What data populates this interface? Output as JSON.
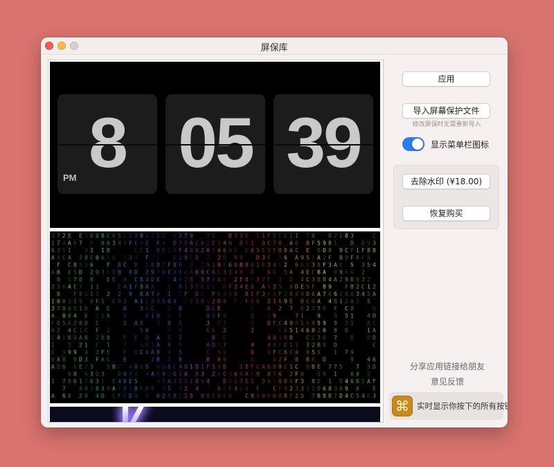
{
  "window": {
    "title": "屏保库"
  },
  "previews": {
    "clock": {
      "hour": "8",
      "minute": "05",
      "second": "39",
      "ampm": "PM"
    },
    "matrix": {
      "chars": "0123456789ABCDEF",
      "colors": [
        "#6fcf3a",
        "#2ec4a6",
        "#2f7fe0",
        "#7a3cf0",
        "#c03ad6",
        "#e0407a",
        "#e64a2f",
        "#e89a2a",
        "#d2d23a",
        "#68d84a"
      ]
    }
  },
  "sidebar": {
    "apply_label": "应用",
    "import_label": "导入屏幕保护文件",
    "import_hint": "修改屏保时无需重新导入",
    "menubar_toggle_label": "显示菜单栏图标",
    "menubar_toggle_on": true,
    "remove_watermark_label": "去除水印 (¥18.00)",
    "restore_purchase_label": "恢复购买",
    "share_label": "分享应用链接给朋友",
    "feedback_label": "意见反馈",
    "promo": {
      "icon": "command-key-icon",
      "text": "实时显示你按下的所有按键"
    }
  }
}
